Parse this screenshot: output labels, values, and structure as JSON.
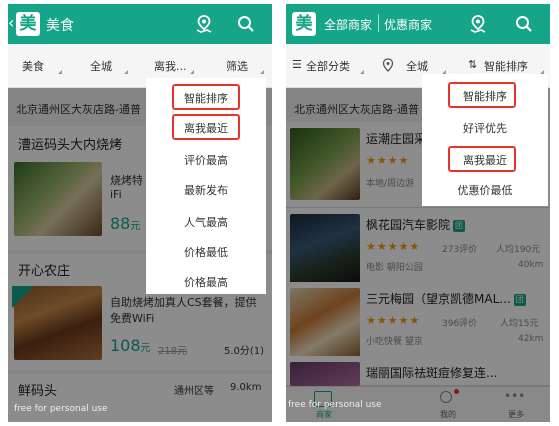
{
  "left": {
    "header": {
      "logo": "美",
      "title": "美食"
    },
    "filters": [
      "美食",
      "全城",
      "离我...",
      "筛选"
    ],
    "address": "北京通州区大灰店路-通普",
    "sections": [
      {
        "title": "漕运码头大内烧烤",
        "item_text": "烧烤特",
        "item_text2": "iFi",
        "price": "88",
        "yuan": "元"
      },
      {
        "title": "开心农庄",
        "promo_text": "自助烧烤加真人CS套餐，提供",
        "promo_text2": "免费WiFi",
        "price": "108",
        "yuan": "元",
        "old_price": "218元",
        "rating": "5.0分(1)"
      },
      {
        "title": "鲜码头",
        "area": "通州区等",
        "distance": "9.0km"
      }
    ],
    "menu": [
      "智能排序",
      "离我最近",
      "评价最高",
      "最新发布",
      "人气最高",
      "价格最低",
      "价格最高"
    ],
    "watermark": "free for personal use"
  },
  "right": {
    "header": {
      "logo": "美",
      "tab_all": "全部商家",
      "tab_deals": "优惠商家"
    },
    "filters": [
      "全部分类",
      "全城",
      "智能排序"
    ],
    "address": "北京通州区大灰店路-通普",
    "merchants": [
      {
        "name": "运潮庄园采",
        "stars": "★★★★",
        "sub": "本地/周边游",
        "review": "",
        "avg": "",
        "dist": ""
      },
      {
        "name": "枫花园汽车影院",
        "stars": "★★★★★",
        "review": "273评价",
        "avg": "人均190元",
        "sub": "电影  朝阳公园",
        "dist": "40km"
      },
      {
        "name": "三元梅园（望京凯德MAL...",
        "stars": "★★★★★",
        "review": "396评价",
        "avg": "人均15元",
        "sub": "小吃快餐  望京",
        "dist": "42km"
      },
      {
        "name": "瑞丽国际祛斑痘修复连...",
        "stars": "",
        "review": "",
        "avg": "",
        "sub": "",
        "dist": ""
      }
    ],
    "menu": [
      "智能排序",
      "好评优先",
      "离我最近",
      "优惠价最低"
    ],
    "bottom_nav": [
      "商家",
      "我的",
      "更多"
    ],
    "watermark": "free for personal use"
  },
  "colors": {
    "brand": "#17a589",
    "highlight": "#e8352b",
    "star": "#f39c12"
  }
}
